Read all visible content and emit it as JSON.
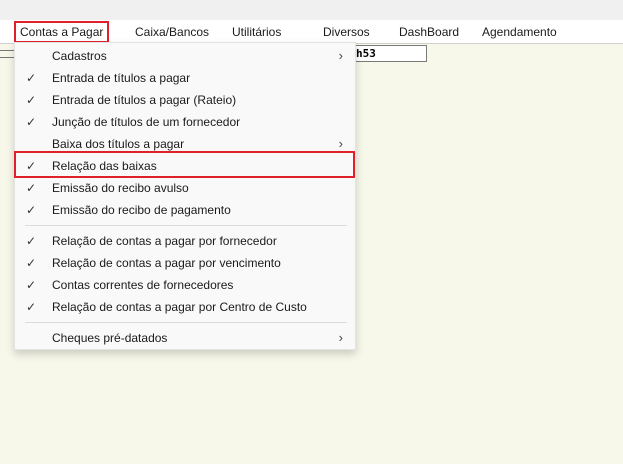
{
  "menubar": {
    "items": [
      {
        "label": "Contas a Pagar"
      },
      {
        "label": "Caixa/Bancos"
      },
      {
        "label": "Utilitários"
      },
      {
        "label": "Diversos"
      },
      {
        "label": "DashBoard"
      },
      {
        "label": "Agendamento"
      }
    ]
  },
  "background": {
    "field_value": "h53"
  },
  "dropdown": {
    "items": [
      {
        "label": "Cadastros",
        "checked": false,
        "submenu": true
      },
      {
        "label": "Entrada de títulos a pagar",
        "checked": true,
        "submenu": false
      },
      {
        "label": "Entrada de títulos a pagar (Rateio)",
        "checked": true,
        "submenu": false
      },
      {
        "label": "Junção de títulos de um fornecedor",
        "checked": true,
        "submenu": false
      },
      {
        "label": "Baixa dos títulos a pagar",
        "checked": false,
        "submenu": true
      },
      {
        "label": "Relação das baixas",
        "checked": true,
        "submenu": false
      },
      {
        "label": "Emissão do recibo avulso",
        "checked": true,
        "submenu": false
      },
      {
        "label": "Emissão do recibo de pagamento",
        "checked": true,
        "submenu": false
      },
      {
        "label": "Relação de contas a pagar por fornecedor",
        "checked": true,
        "submenu": false
      },
      {
        "label": "Relação de contas a pagar por vencimento",
        "checked": true,
        "submenu": false
      },
      {
        "label": "Contas correntes de fornecedores",
        "checked": true,
        "submenu": false
      },
      {
        "label": "Relação de contas a pagar por Centro de Custo",
        "checked": true,
        "submenu": false
      },
      {
        "label": "Cheques pré-datados",
        "checked": false,
        "submenu": true
      }
    ],
    "check_glyph": "✓",
    "submenu_glyph": "›"
  },
  "colors": {
    "highlight_border": "#e0202a",
    "background": "#f7f8ea"
  }
}
